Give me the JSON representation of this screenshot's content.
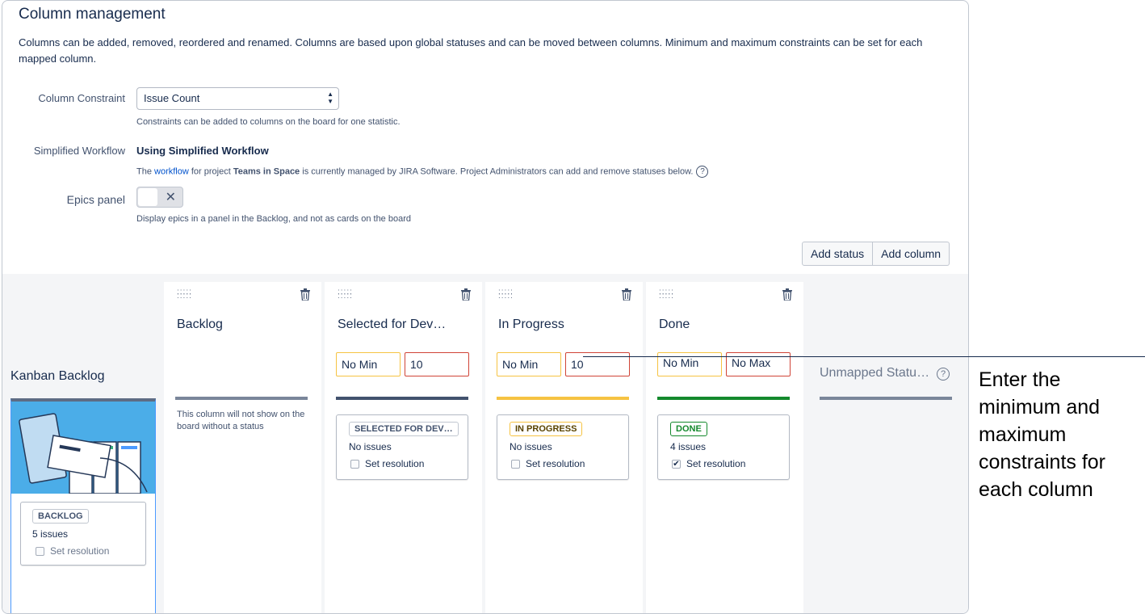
{
  "header": {
    "title": "Column management",
    "description": "Columns can be added, removed, reordered and renamed. Columns are based upon global statuses and can be moved between columns. Minimum and maximum constraints can be set for each mapped column."
  },
  "settings": {
    "constraint_label": "Column Constraint",
    "constraint_value": "Issue Count",
    "constraint_hint": "Constraints can be added to columns on the board for one statistic.",
    "workflow_label": "Simplified Workflow",
    "workflow_value": "Using Simplified Workflow",
    "workflow_hint_pre": "The ",
    "workflow_link": "workflow",
    "workflow_hint_mid": " for project ",
    "workflow_project": "Teams in Space",
    "workflow_hint_post": " is currently managed by JIRA Software. Project Administrators can add and remove statuses below.",
    "epics_label": "Epics panel",
    "epics_toggle_icon": "close-icon",
    "epics_hint": "Display epics in a panel in the Backlog, and not as cards on the board"
  },
  "actions": {
    "add_status": "Add status",
    "add_column": "Add column"
  },
  "kanban": {
    "label": "Kanban Backlog",
    "card": {
      "status": "BACKLOG",
      "count": "5 issues",
      "resolution": "Set resolution"
    }
  },
  "columns": [
    {
      "name": "Backlog",
      "note": "This column will not show on the board without a status",
      "color": "#7a869a"
    },
    {
      "name": "Selected for Dev…",
      "min": "No Min",
      "max": "10",
      "color": "#42526e",
      "status": "SELECTED FOR DEV…",
      "count": "No issues",
      "resolution": "Set resolution",
      "checked": false
    },
    {
      "name": "In Progress",
      "min": "No Min",
      "max": "10",
      "color": "#f6c342",
      "status": "IN PROGRESS",
      "count": "No issues",
      "resolution": "Set resolution",
      "checked": false
    },
    {
      "name": "Done",
      "min": "No Min",
      "max": "No Max",
      "color": "#14892c",
      "status": "DONE",
      "count": "4 issues",
      "resolution": "Set resolution",
      "checked": true
    }
  ],
  "unmapped": {
    "label": "Unmapped Statu…",
    "help": "?"
  },
  "callout": {
    "text": "Enter the minimum and maximum constraints for each column"
  }
}
